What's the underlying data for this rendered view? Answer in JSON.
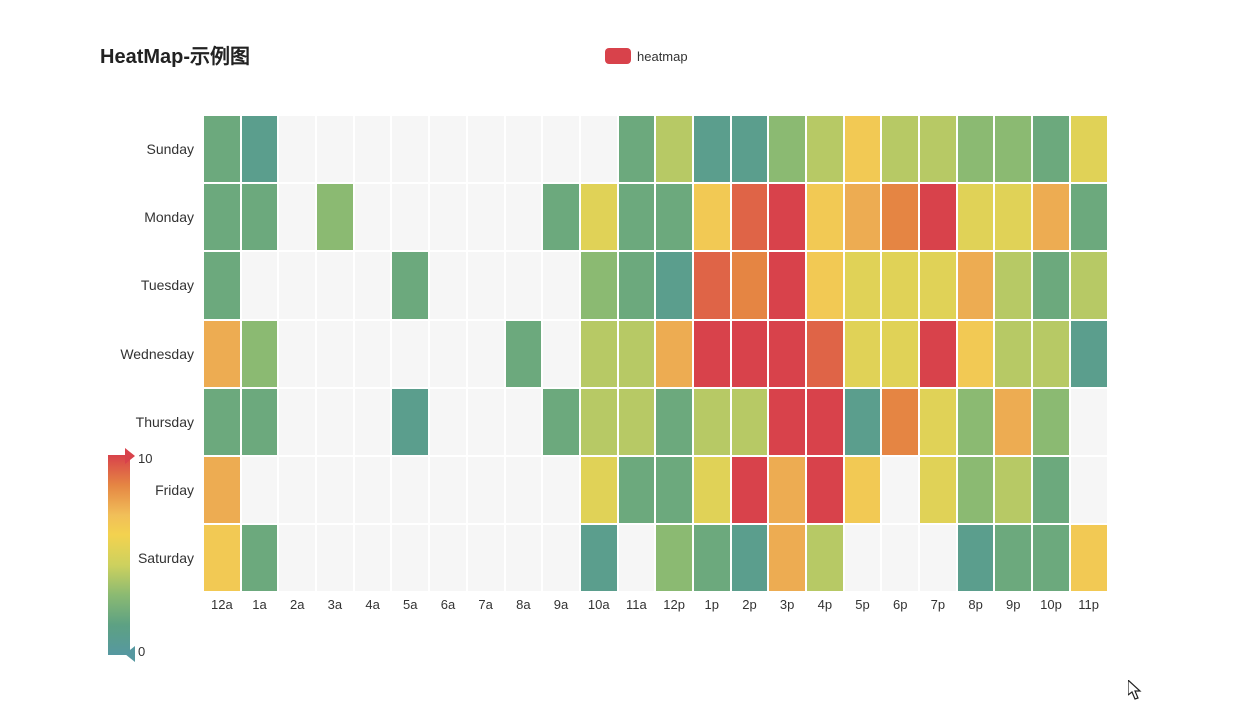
{
  "title": "HeatMap-示例图",
  "legend_label": "heatmap",
  "legend_color": "#d8424b",
  "vmin": 0,
  "vmax": 10,
  "vmin_label": "0",
  "vmax_label": "10",
  "chart_data": {
    "type": "heatmap",
    "title": "HeatMap-示例图",
    "xlabel": "",
    "ylabel": "",
    "x": [
      "12a",
      "1a",
      "2a",
      "3a",
      "4a",
      "5a",
      "6a",
      "7a",
      "8a",
      "9a",
      "10a",
      "11a",
      "12p",
      "1p",
      "2p",
      "3p",
      "4p",
      "5p",
      "6p",
      "7p",
      "8p",
      "9p",
      "10p",
      "11p"
    ],
    "y": [
      "Sunday",
      "Monday",
      "Tuesday",
      "Wednesday",
      "Thursday",
      "Friday",
      "Saturday"
    ],
    "zlim": [
      0,
      10
    ],
    "colorscale": [
      "#5698a0",
      "#5da183",
      "#8bba72",
      "#cdd15e",
      "#f3d24f",
      "#f1bf59",
      "#e58543",
      "#d8424b"
    ],
    "z": [
      [
        2,
        1,
        0,
        0,
        0,
        0,
        0,
        0,
        0,
        0,
        0,
        2,
        4,
        1,
        1,
        3,
        4,
        6,
        4,
        4,
        3,
        3,
        2,
        5
      ],
      [
        2,
        2,
        0,
        3,
        0,
        0,
        0,
        0,
        0,
        2,
        5,
        2,
        2,
        6,
        9,
        11,
        6,
        7,
        8,
        12,
        5,
        5,
        7,
        2
      ],
      [
        2,
        0,
        0,
        0,
        0,
        2,
        0,
        0,
        0,
        0,
        3,
        2,
        1,
        9,
        8,
        10,
        6,
        5,
        5,
        5,
        7,
        4,
        2,
        4
      ],
      [
        7,
        3,
        0,
        0,
        0,
        0,
        0,
        0,
        2,
        0,
        4,
        4,
        7,
        14,
        13,
        12,
        9,
        5,
        5,
        10,
        6,
        4,
        4,
        1
      ],
      [
        2,
        2,
        0,
        0,
        0,
        1,
        0,
        0,
        0,
        2,
        4,
        4,
        2,
        4,
        4,
        14,
        12,
        1,
        8,
        5,
        3,
        7,
        3,
        0
      ],
      [
        7,
        0,
        0,
        0,
        0,
        0,
        0,
        0,
        0,
        0,
        5,
        2,
        2,
        5,
        10,
        7,
        11,
        6,
        0,
        5,
        3,
        4,
        2,
        0
      ],
      [
        6,
        2,
        0,
        0,
        0,
        0,
        0,
        0,
        0,
        0,
        1,
        0,
        3,
        2,
        1,
        7,
        4,
        0,
        0,
        0,
        1,
        2,
        2,
        6
      ]
    ]
  }
}
